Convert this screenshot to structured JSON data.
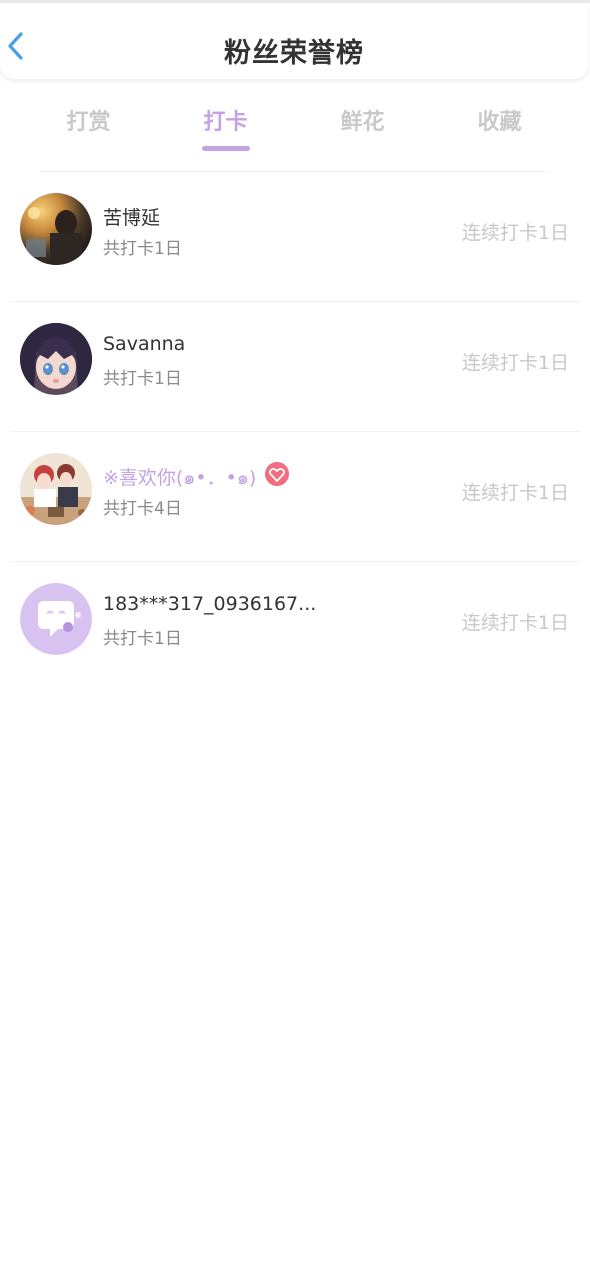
{
  "header": {
    "title": "粉丝荣誉榜",
    "back_icon": "chevron-left-icon",
    "accent_color": "#4a9fe0"
  },
  "tabs": [
    {
      "label": "打赏",
      "active": false
    },
    {
      "label": "打卡",
      "active": true
    },
    {
      "label": "鲜花",
      "active": false
    },
    {
      "label": "收藏",
      "active": false
    }
  ],
  "theme": {
    "accent": "#c5a3e3",
    "inactive_tab": "#c9c9cc",
    "muted_text": "#8a8a8a"
  },
  "fans": [
    {
      "name": "苦博延",
      "total": "共打卡1日",
      "streak": "连续打卡1日",
      "avatar": "photo-avatar"
    },
    {
      "name": "Savanna",
      "total": "共打卡1日",
      "streak": "连续打卡1日",
      "avatar": "anime-girl-avatar"
    },
    {
      "name": "※喜欢你(๑•．•๑)",
      "total": "共打卡4日",
      "streak": "连续打卡1日",
      "avatar": "anime-couple-avatar",
      "vip": true,
      "badge_icon": "heart-gem-badge-icon"
    },
    {
      "name": "183***317_0936167...",
      "total": "共打卡1日",
      "streak": "连续打卡1日",
      "avatar": "chat-bubble-default-avatar"
    }
  ]
}
